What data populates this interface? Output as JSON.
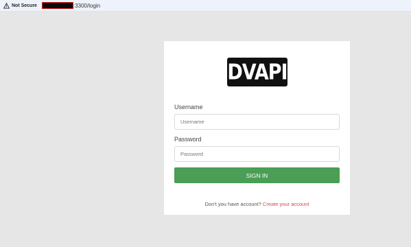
{
  "browser": {
    "security_label": "Not Secure",
    "url_visible_tail": ":3300/login"
  },
  "login": {
    "logo_text": "DVAPI",
    "username_label": "Username",
    "username_placeholder": "Username",
    "password_label": "Password",
    "password_placeholder": "Password",
    "signin_label": "SIGN IN",
    "account_prompt": "Don't you have account? ",
    "create_link": "Create your account"
  },
  "colors": {
    "background": "#e6e6e6",
    "signin_button": "#4a9e55",
    "link": "#e0434a"
  }
}
